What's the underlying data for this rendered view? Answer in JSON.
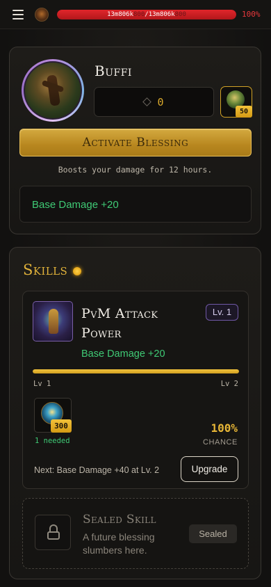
{
  "topbar": {
    "hp": {
      "current_a": "13m806k",
      "current_b": "800",
      "separator": "/",
      "max_a": "13m806k",
      "max_b": "800",
      "percent_label": "100%",
      "fill": 1.0
    }
  },
  "buff": {
    "name": "Buffi",
    "cost_value": "0",
    "item_count": "50",
    "activate_label": "Activate Blessing",
    "activate_desc": "Boosts your damage for 12 hours.",
    "bonus": "Base Damage +20"
  },
  "skills": {
    "title": "Skills",
    "card": {
      "name": "PvM Attack Power",
      "level_badge": "Lv. 1",
      "effect": "Base Damage +20",
      "progress": 1.0,
      "level_from": "Lv 1",
      "level_to": "Lv 2",
      "req_count": "300",
      "req_needed": "1 needed",
      "chance_value": "100%",
      "chance_label": "CHANCE",
      "next_text": "Next: Base Damage +40 at Lv. 2",
      "upgrade_label": "Upgrade"
    },
    "sealed": {
      "title": "Sealed Skill",
      "desc": "A future blessing slumbers here.",
      "tag": "Sealed"
    }
  },
  "colors": {
    "gold": "#e1b23a",
    "green": "#3fca75",
    "hp_red": "#e0262b",
    "lv_purple": "#7058a6"
  },
  "icons": [
    "menu-icon",
    "coin-icon",
    "diamond-icon",
    "lock-icon"
  ]
}
